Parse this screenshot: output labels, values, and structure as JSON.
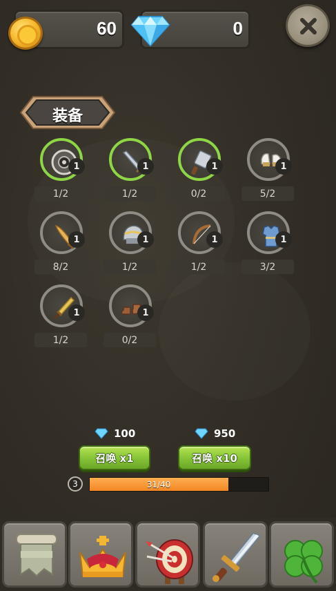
{
  "currencies": {
    "gold": {
      "value": "60",
      "icon": "gold-coin-icon"
    },
    "diamond": {
      "value": "0",
      "icon": "diamond-icon"
    }
  },
  "close": {
    "icon": "close-icon"
  },
  "section": {
    "title": "装备"
  },
  "equipment": [
    {
      "icon": "shield-icon",
      "level": "1",
      "count": "1/2",
      "ring": "green"
    },
    {
      "icon": "sword-icon",
      "level": "1",
      "count": "1/2",
      "ring": "green"
    },
    {
      "icon": "cleaver-icon",
      "level": "1",
      "count": "0/2",
      "ring": "green"
    },
    {
      "icon": "gloves-icon",
      "level": "1",
      "count": "5/2",
      "ring": "gray"
    },
    {
      "icon": "wooden-sword-icon",
      "level": "1",
      "count": "8/2",
      "ring": "gray"
    },
    {
      "icon": "helmet-icon",
      "level": "1",
      "count": "1/2",
      "ring": "gray"
    },
    {
      "icon": "bow-icon",
      "level": "1",
      "count": "1/2",
      "ring": "gray"
    },
    {
      "icon": "armor-icon",
      "level": "1",
      "count": "3/2",
      "ring": "gray"
    },
    {
      "icon": "dagger-icon",
      "level": "1",
      "count": "1/2",
      "ring": "gray"
    },
    {
      "icon": "boots-icon",
      "level": "1",
      "count": "0/2",
      "ring": "gray"
    }
  ],
  "summon": {
    "single": {
      "price": "100",
      "label": "召唤 x1"
    },
    "ten": {
      "price": "950",
      "label": "召唤 x10"
    }
  },
  "progress": {
    "level": "3",
    "current": 31,
    "max": 40,
    "label": "31/40"
  },
  "nav": [
    {
      "icon": "banner-icon"
    },
    {
      "icon": "crown-icon"
    },
    {
      "icon": "archery-target-icon"
    },
    {
      "icon": "sword-icon"
    },
    {
      "icon": "clover-icon"
    }
  ],
  "colors": {
    "accent_green": "#8ed645",
    "button_green": "#8cc83a",
    "progress_orange": "#f28722",
    "background": "#332f27"
  }
}
